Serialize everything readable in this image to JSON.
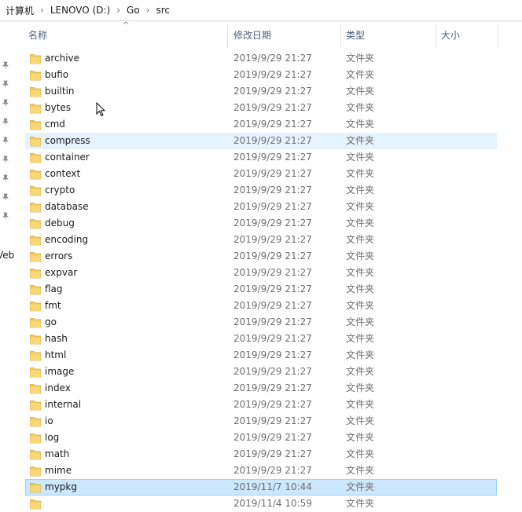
{
  "breadcrumb": [
    {
      "label": "计算机"
    },
    {
      "label": "LENOVO (D:)"
    },
    {
      "label": "Go"
    },
    {
      "label": "src"
    }
  ],
  "left_clip_text": "Veb",
  "columns": {
    "name": "名称",
    "date": "修改日期",
    "type": "类型",
    "size": "大小"
  },
  "rows": [
    {
      "name": "archive",
      "date": "2019/9/29 21:27",
      "type": "文件夹"
    },
    {
      "name": "bufio",
      "date": "2019/9/29 21:27",
      "type": "文件夹"
    },
    {
      "name": "builtin",
      "date": "2019/9/29 21:27",
      "type": "文件夹"
    },
    {
      "name": "bytes",
      "date": "2019/9/29 21:27",
      "type": "文件夹"
    },
    {
      "name": "cmd",
      "date": "2019/9/29 21:27",
      "type": "文件夹"
    },
    {
      "name": "compress",
      "date": "2019/9/29 21:27",
      "type": "文件夹",
      "state": "hover"
    },
    {
      "name": "container",
      "date": "2019/9/29 21:27",
      "type": "文件夹"
    },
    {
      "name": "context",
      "date": "2019/9/29 21:27",
      "type": "文件夹"
    },
    {
      "name": "crypto",
      "date": "2019/9/29 21:27",
      "type": "文件夹"
    },
    {
      "name": "database",
      "date": "2019/9/29 21:27",
      "type": "文件夹"
    },
    {
      "name": "debug",
      "date": "2019/9/29 21:27",
      "type": "文件夹"
    },
    {
      "name": "encoding",
      "date": "2019/9/29 21:27",
      "type": "文件夹"
    },
    {
      "name": "errors",
      "date": "2019/9/29 21:27",
      "type": "文件夹"
    },
    {
      "name": "expvar",
      "date": "2019/9/29 21:27",
      "type": "文件夹"
    },
    {
      "name": "flag",
      "date": "2019/9/29 21:27",
      "type": "文件夹"
    },
    {
      "name": "fmt",
      "date": "2019/9/29 21:27",
      "type": "文件夹"
    },
    {
      "name": "go",
      "date": "2019/9/29 21:27",
      "type": "文件夹"
    },
    {
      "name": "hash",
      "date": "2019/9/29 21:27",
      "type": "文件夹"
    },
    {
      "name": "html",
      "date": "2019/9/29 21:27",
      "type": "文件夹"
    },
    {
      "name": "image",
      "date": "2019/9/29 21:27",
      "type": "文件夹"
    },
    {
      "name": "index",
      "date": "2019/9/29 21:27",
      "type": "文件夹"
    },
    {
      "name": "internal",
      "date": "2019/9/29 21:27",
      "type": "文件夹"
    },
    {
      "name": "io",
      "date": "2019/9/29 21:27",
      "type": "文件夹"
    },
    {
      "name": "log",
      "date": "2019/9/29 21:27",
      "type": "文件夹"
    },
    {
      "name": "math",
      "date": "2019/9/29 21:27",
      "type": "文件夹"
    },
    {
      "name": "mime",
      "date": "2019/9/29 21:27",
      "type": "文件夹"
    },
    {
      "name": "mypkg",
      "date": "2019/11/7 10:44",
      "type": "文件夹",
      "state": "selected"
    },
    {
      "name": "",
      "date": "2019/11/4 10:59",
      "type": "文件夹"
    }
  ],
  "colors": {
    "folder": "#f4c95d",
    "hover": "#e5f3ff",
    "selected": "#cce8ff",
    "header_text": "#4c607a"
  },
  "icons": {
    "folder": "folder-icon",
    "pin": "pin-icon",
    "cursor": "mouse-cursor-icon"
  }
}
